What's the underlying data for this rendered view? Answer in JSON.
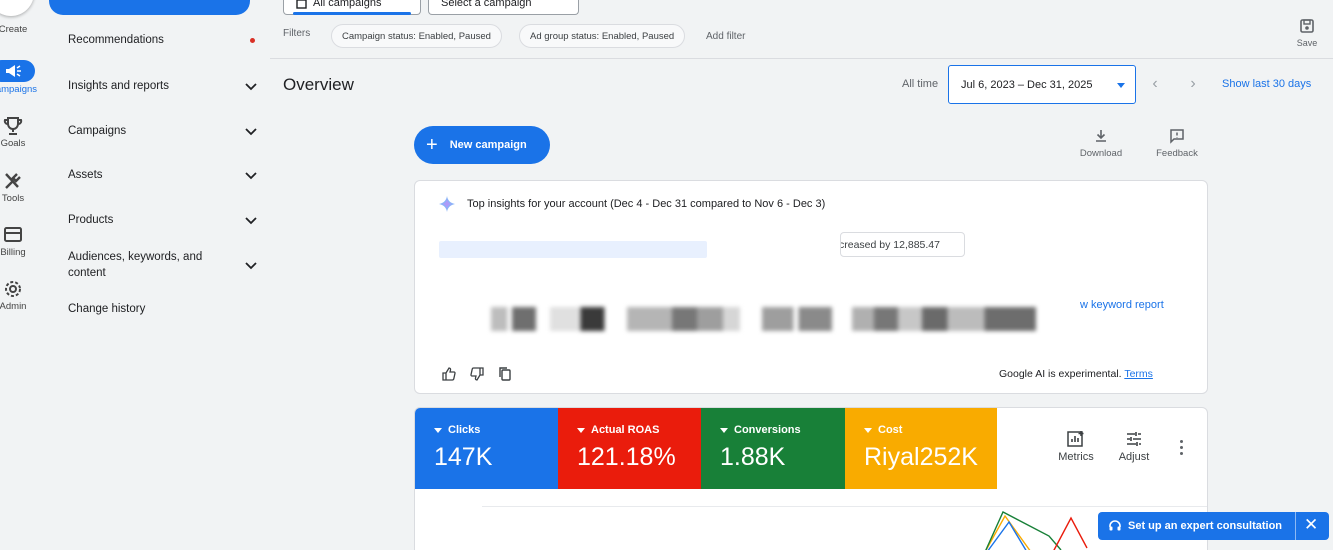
{
  "rail": {
    "items": [
      {
        "label": "Create"
      },
      {
        "label": "Campaigns"
      },
      {
        "label": "Goals"
      },
      {
        "label": "Tools"
      },
      {
        "label": "Billing"
      },
      {
        "label": "Admin"
      }
    ]
  },
  "nav": {
    "items": [
      {
        "label": "Recommendations"
      },
      {
        "label": "Insights and reports"
      },
      {
        "label": "Campaigns"
      },
      {
        "label": "Assets"
      },
      {
        "label": "Products"
      },
      {
        "label": "Audiences, keywords, and content"
      },
      {
        "label": "Change history"
      }
    ]
  },
  "header": {
    "tabs": [
      {
        "label": "All campaigns"
      },
      {
        "label": "Select a campaign"
      }
    ],
    "filters_label": "Filters",
    "chips": [
      {
        "label": "Campaign status: Enabled, Paused"
      },
      {
        "label": "Ad group status: Enabled, Paused"
      }
    ],
    "add_filter": "Add filter",
    "save_label": "Save"
  },
  "overview": {
    "title": "Overview",
    "all_time": "All time",
    "date_range": "Jul 6, 2023 – Dec 31, 2025",
    "show_last": "Show last 30 days",
    "new_campaign": "New campaign",
    "download": "Download",
    "feedback": "Feedback"
  },
  "insights": {
    "title": "Top insights for your account (Dec 4 - Dec 31 compared to Nov 6 - Dec 3)",
    "increase_chip": "creased by 12,885.47",
    "keyword_link": "w keyword report",
    "ai_note": "Google AI is experimental.",
    "terms": "Terms"
  },
  "metrics": {
    "tiles": [
      {
        "name": "Clicks",
        "value": "147K",
        "color": "#1a73e8"
      },
      {
        "name": "Actual ROAS",
        "value": "121.18%",
        "color": "#ea1c0c"
      },
      {
        "name": "Conversions",
        "value": "1.88K",
        "color": "#188038"
      },
      {
        "name": "Cost",
        "value": "Riyal252K",
        "color": "#f9ab00"
      }
    ],
    "metrics_label": "Metrics",
    "adjust_label": "Adjust"
  },
  "consult": {
    "label": "Set up an expert consultation"
  },
  "colors": {
    "accent": "#1a73e8",
    "alert_dot": "#d93025"
  }
}
